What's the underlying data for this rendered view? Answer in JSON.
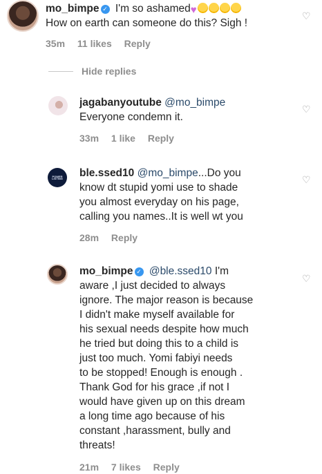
{
  "comments": [
    {
      "username": "mo_bimpe",
      "verified": true,
      "text": "I'm so ashamed",
      "emojis": [
        "heart",
        "face",
        "face",
        "face",
        "face"
      ],
      "line2": "How on earth can someone do this? Sigh !",
      "time": "35m",
      "likes": "11 likes",
      "reply": "Reply"
    },
    {
      "username": "jagabanyoutube",
      "mention": "@mo_bimpe",
      "line2": "Everyone condemn it.",
      "time": "33m",
      "likes": "1 like",
      "reply": "Reply"
    },
    {
      "username": "ble.ssed10",
      "mention": "@mo_bimpe",
      "text_lines": [
        "...Do you",
        "know dt stupid yomi use to shade",
        "you almost everyday on his page,",
        "calling you names..It is well wt you"
      ],
      "time": "28m",
      "reply": "Reply",
      "avatar_text": "POWER LISTING"
    },
    {
      "username": "mo_bimpe",
      "verified": true,
      "mention": "@ble.ssed10",
      "text_lines": [
        "I'm",
        "aware ,I just decided to always",
        "ignore.  The major reason is because",
        "I didn't make myself available for",
        "his sexual needs despite how much",
        "he tried but doing this to a child is",
        "just too much.  Yomi fabiyi needs",
        "to be stopped! Enough is enough .",
        "Thank God for his grace ,if not I",
        "would have given up on this dream",
        "a long time ago because of his",
        "constant ,harassment, bully and",
        "threats!"
      ],
      "time": "21m",
      "likes": "7 likes",
      "reply": "Reply"
    }
  ],
  "hide_replies": "Hide replies",
  "icons": {
    "like": "heart-outline-icon",
    "verified": "verified-badge-icon"
  }
}
